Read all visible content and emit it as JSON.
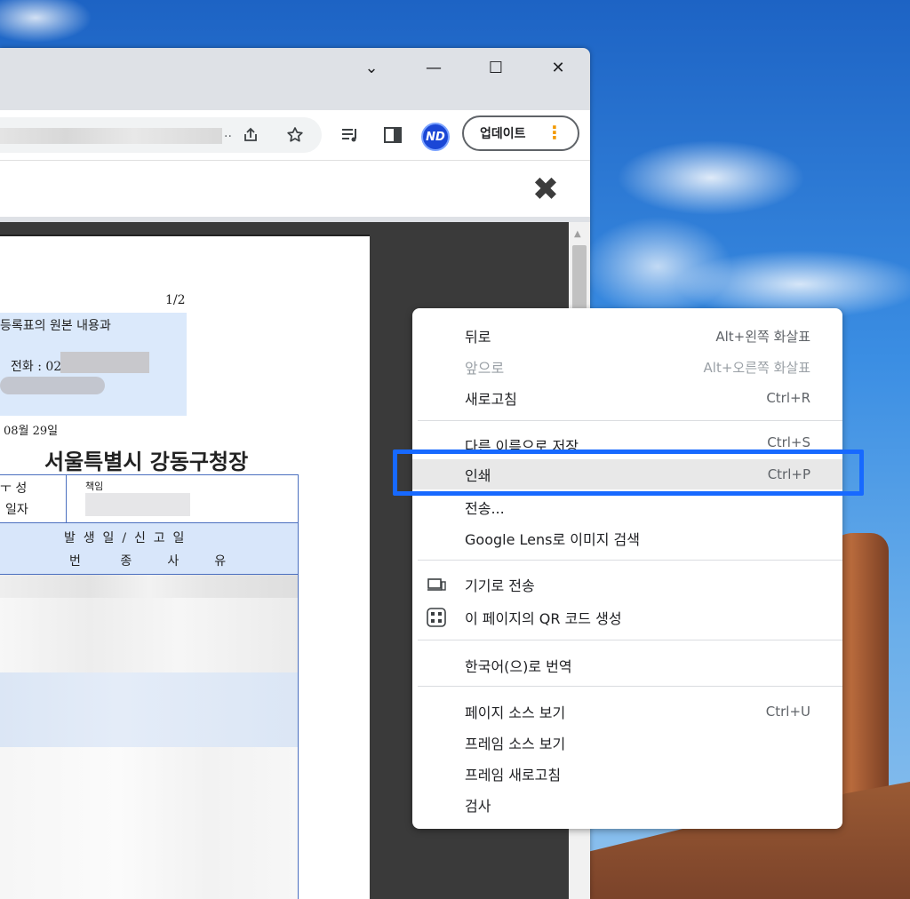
{
  "browser": {
    "window_controls": {
      "tab_search": "⌄",
      "minimize": "—",
      "maximize": "☐",
      "close": "✕"
    },
    "toolbar": {
      "url_ellipsis": "..",
      "profile_initials": "ND",
      "update_label": "업데이트",
      "update_menu_glyph": "⋮"
    }
  },
  "document": {
    "page_number": "1/2",
    "line1": "등록표의 원본 내용과",
    "line2": "전화 : 02",
    "date": "08월 29일",
    "issuer": "서울특별시 강동구청장",
    "table": {
      "row1_left_top": "ㅜ 성",
      "row1_left_bottom": "일자",
      "row1_right": "책임",
      "header_top": "발  생  일  /  신  고  일",
      "header_bottom": "번          종         사         유"
    }
  },
  "viewer": {
    "close_glyph": "✖"
  },
  "context_menu": {
    "items": [
      {
        "label": "뒤로",
        "shortcut": "Alt+왼쪽 화살표",
        "enabled": true
      },
      {
        "label": "앞으로",
        "shortcut": "Alt+오른쪽 화살표",
        "enabled": false
      },
      {
        "label": "새로고침",
        "shortcut": "Ctrl+R",
        "enabled": true
      },
      {
        "label": "다른 이름으로 저장...",
        "shortcut": "Ctrl+S",
        "enabled": true
      },
      {
        "label": "인쇄",
        "shortcut": "Ctrl+P",
        "enabled": true,
        "highlighted": true
      },
      {
        "label": "전송...",
        "shortcut": "",
        "enabled": true
      },
      {
        "label": "Google Lens로 이미지 검색",
        "shortcut": "",
        "enabled": true
      },
      {
        "label": "기기로 전송",
        "shortcut": "",
        "icon": "device-icon",
        "enabled": true
      },
      {
        "label": "이 페이지의 QR 코드 생성",
        "shortcut": "",
        "icon": "qr-code-icon",
        "enabled": true
      },
      {
        "label": "한국어(으)로 번역",
        "shortcut": "",
        "enabled": true
      },
      {
        "label": "페이지 소스 보기",
        "shortcut": "Ctrl+U",
        "enabled": true
      },
      {
        "label": "프레임 소스 보기",
        "shortcut": "",
        "enabled": true
      },
      {
        "label": "프레임 새로고침",
        "shortcut": "",
        "enabled": true
      },
      {
        "label": "검사",
        "shortcut": "",
        "enabled": true
      }
    ]
  },
  "colors": {
    "highlight_border": "#1769ff",
    "avatar_bg": "#1a47d6",
    "update_dots": "#f29900"
  }
}
